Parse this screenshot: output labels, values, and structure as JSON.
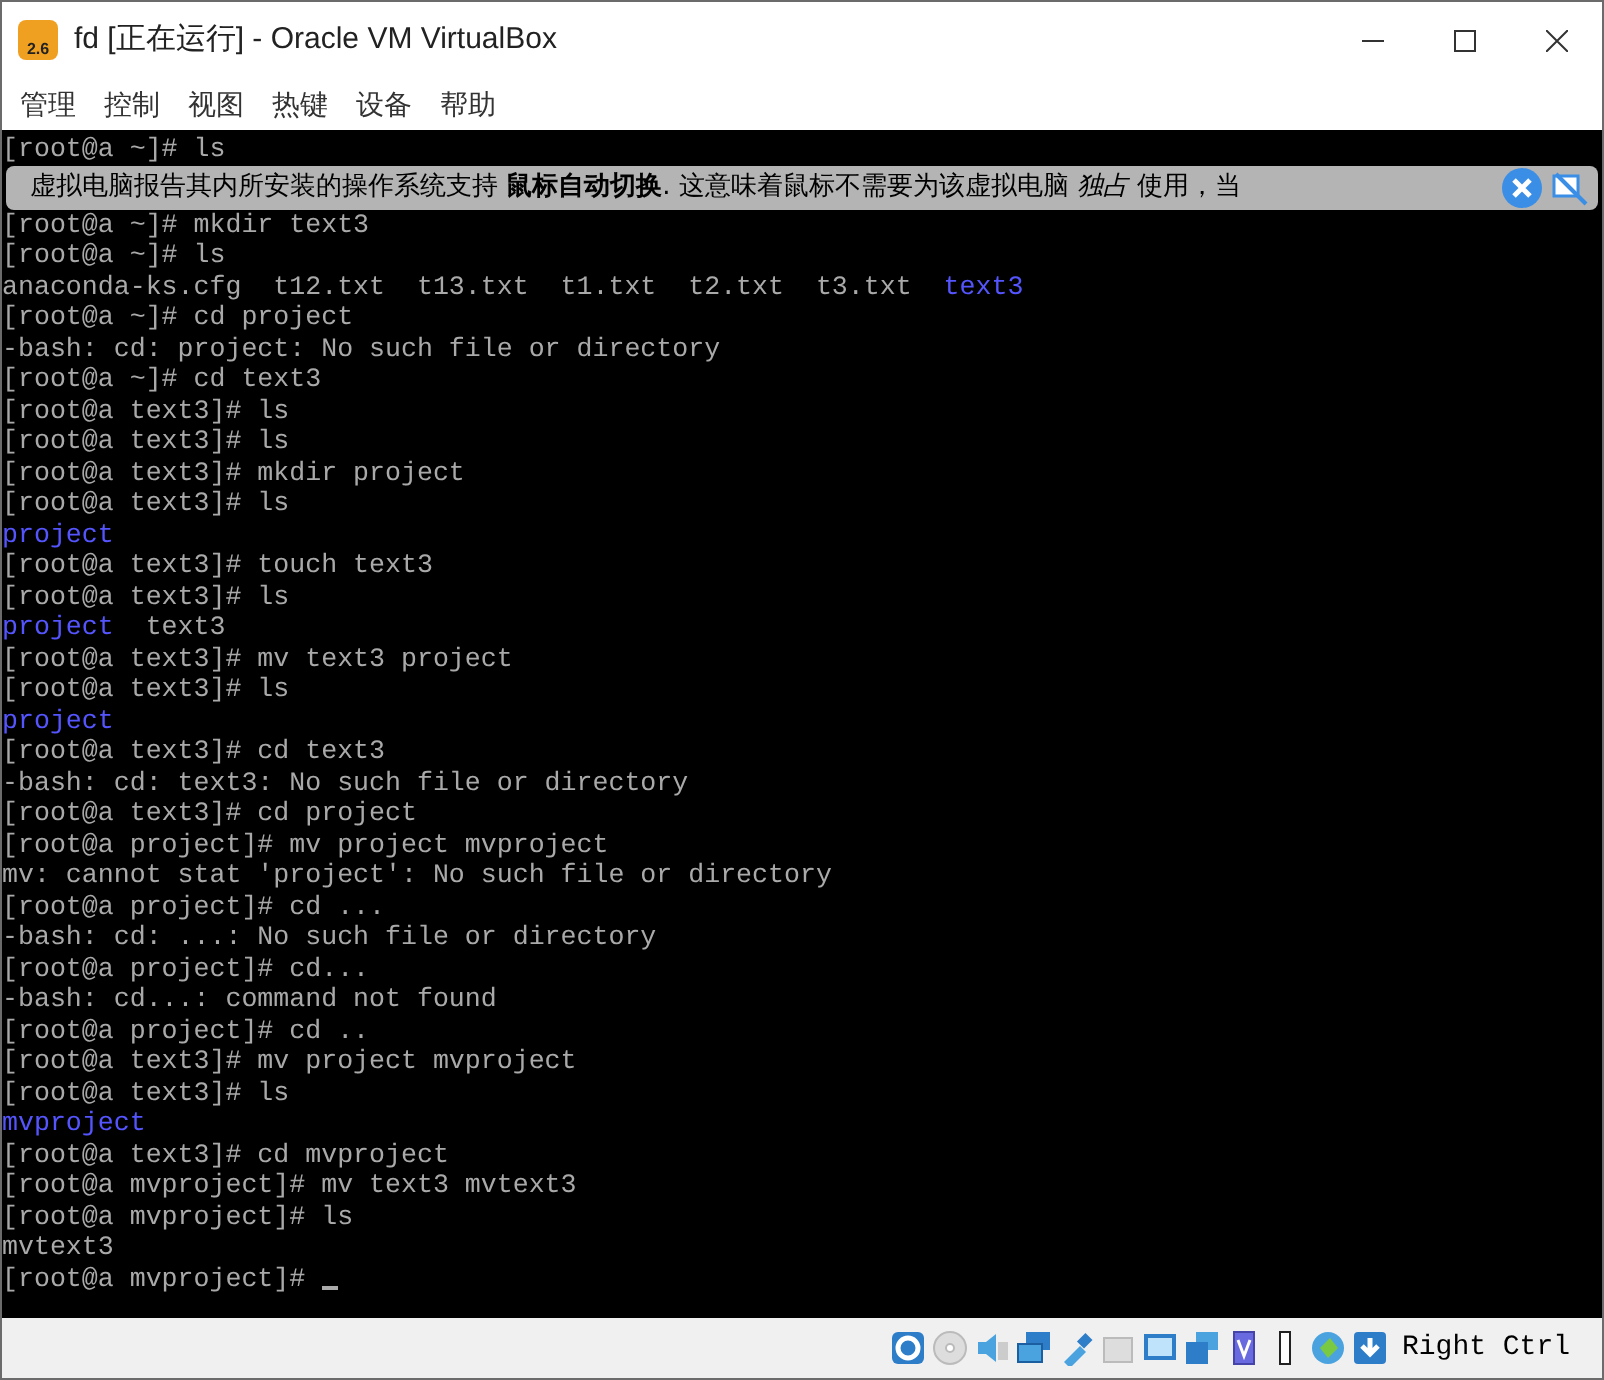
{
  "window": {
    "title": "fd [正在运行] - Oracle VM VirtualBox",
    "logo_text": "2.6"
  },
  "menu": [
    "管理",
    "控制",
    "视图",
    "热键",
    "设备",
    "帮助"
  ],
  "notice": {
    "text": "虚拟电脑报告其内所安装的操作系统支持 **鼠标自动切换**. 这意味着鼠标不需要为该虚拟电脑 *独占* 使用，当"
  },
  "terminal": {
    "lines_above": [
      [
        {
          "text": "[root@a ~]# ls",
          "kind": "plain"
        }
      ]
    ],
    "lines": [
      [
        {
          "text": "[root@a ~]# mkdir text3",
          "kind": "plain"
        }
      ],
      [
        {
          "text": "[root@a ~]# ls",
          "kind": "plain"
        }
      ],
      [
        {
          "text": "anaconda-ks.cfg  t12.txt  t13.txt  t1.txt  t2.txt  t3.txt  ",
          "kind": "plain"
        },
        {
          "text": "text3",
          "kind": "dir"
        }
      ],
      [
        {
          "text": "[root@a ~]# cd project",
          "kind": "plain"
        }
      ],
      [
        {
          "text": "-bash: cd: project: No such file or directory",
          "kind": "plain"
        }
      ],
      [
        {
          "text": "[root@a ~]# cd text3",
          "kind": "plain"
        }
      ],
      [
        {
          "text": "[root@a text3]# ls",
          "kind": "plain"
        }
      ],
      [
        {
          "text": "[root@a text3]# ls",
          "kind": "plain"
        }
      ],
      [
        {
          "text": "[root@a text3]# mkdir project",
          "kind": "plain"
        }
      ],
      [
        {
          "text": "[root@a text3]# ls",
          "kind": "plain"
        }
      ],
      [
        {
          "text": "project",
          "kind": "dir"
        }
      ],
      [
        {
          "text": "[root@a text3]# touch text3",
          "kind": "plain"
        }
      ],
      [
        {
          "text": "[root@a text3]# ls",
          "kind": "plain"
        }
      ],
      [
        {
          "text": "project",
          "kind": "dir"
        },
        {
          "text": "  text3",
          "kind": "plain"
        }
      ],
      [
        {
          "text": "[root@a text3]# mv text3 project",
          "kind": "plain"
        }
      ],
      [
        {
          "text": "[root@a text3]# ls",
          "kind": "plain"
        }
      ],
      [
        {
          "text": "project",
          "kind": "dir"
        }
      ],
      [
        {
          "text": "[root@a text3]# cd text3",
          "kind": "plain"
        }
      ],
      [
        {
          "text": "-bash: cd: text3: No such file or directory",
          "kind": "plain"
        }
      ],
      [
        {
          "text": "[root@a text3]# cd project",
          "kind": "plain"
        }
      ],
      [
        {
          "text": "[root@a project]# mv project mvproject",
          "kind": "plain"
        }
      ],
      [
        {
          "text": "mv: cannot stat 'project': No such file or directory",
          "kind": "plain"
        }
      ],
      [
        {
          "text": "[root@a project]# cd ...",
          "kind": "plain"
        }
      ],
      [
        {
          "text": "-bash: cd: ...: No such file or directory",
          "kind": "plain"
        }
      ],
      [
        {
          "text": "[root@a project]# cd...",
          "kind": "plain"
        }
      ],
      [
        {
          "text": "-bash: cd...: command not found",
          "kind": "plain"
        }
      ],
      [
        {
          "text": "[root@a project]# cd ..",
          "kind": "plain"
        }
      ],
      [
        {
          "text": "[root@a text3]# mv project mvproject",
          "kind": "plain"
        }
      ],
      [
        {
          "text": "[root@a text3]# ls",
          "kind": "plain"
        }
      ],
      [
        {
          "text": "mvproject",
          "kind": "dir"
        }
      ],
      [
        {
          "text": "[root@a text3]# cd mvproject",
          "kind": "plain"
        }
      ],
      [
        {
          "text": "[root@a mvproject]# mv text3 mvtext3",
          "kind": "plain"
        }
      ],
      [
        {
          "text": "[root@a mvproject]# ls",
          "kind": "plain"
        }
      ],
      [
        {
          "text": "mvtext3",
          "kind": "plain"
        }
      ],
      [
        {
          "text": "[root@a mvproject]# ",
          "kind": "plain"
        }
      ]
    ]
  },
  "status_bar": {
    "host_key": "Right Ctrl"
  }
}
